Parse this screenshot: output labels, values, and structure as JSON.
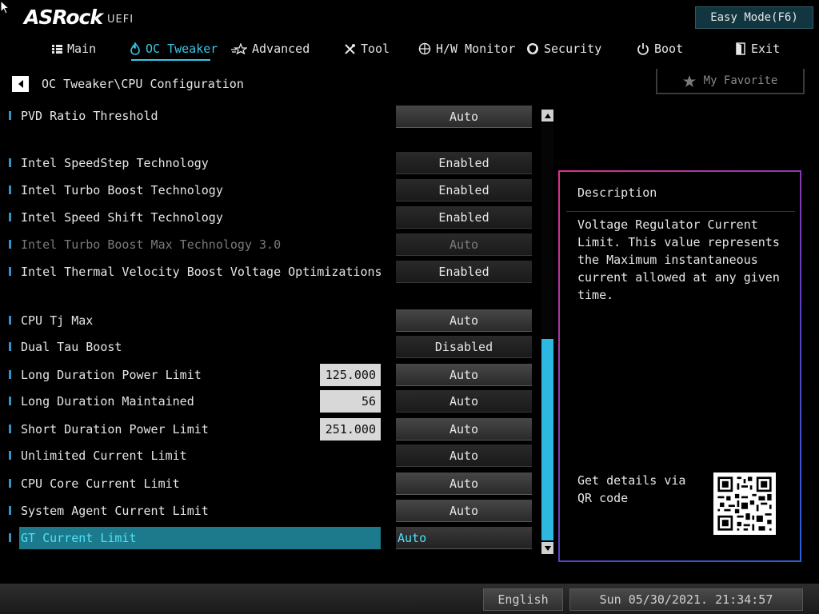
{
  "header": {
    "brand": "ASRock",
    "subbrand": "UEFI",
    "easy_mode_label": "Easy Mode(F6)"
  },
  "nav": {
    "tabs": [
      {
        "label": "Main",
        "icon": "list-icon"
      },
      {
        "label": "OC Tweaker",
        "icon": "flame-icon",
        "active": true
      },
      {
        "label": "Advanced",
        "icon": "star-icon"
      },
      {
        "label": "Tool",
        "icon": "tools-icon"
      },
      {
        "label": "H/W Monitor",
        "icon": "monitor-icon"
      },
      {
        "label": "Security",
        "icon": "shield-icon"
      },
      {
        "label": "Boot",
        "icon": "power-icon"
      },
      {
        "label": "Exit",
        "icon": "exit-icon"
      }
    ]
  },
  "breadcrumb": "OC Tweaker\\CPU Configuration",
  "favorite_label": "My Favorite",
  "settings": [
    {
      "label": "PVD Ratio Threshold",
      "value": "Auto"
    },
    {
      "label": "Intel SpeedStep Technology",
      "value": "Enabled"
    },
    {
      "label": "Intel Turbo Boost Technology",
      "value": "Enabled"
    },
    {
      "label": "Intel Speed Shift Technology",
      "value": "Enabled"
    },
    {
      "label": "Intel Turbo Boost Max Technology 3.0",
      "value": "Auto",
      "disabled": true
    },
    {
      "label": "Intel Thermal Velocity Boost Voltage Optimizations",
      "value": "Enabled"
    },
    {
      "label": "CPU Tj Max",
      "value": "Auto"
    },
    {
      "label": "Dual Tau Boost",
      "value": "Disabled"
    },
    {
      "label": "Long Duration Power Limit",
      "value": "Auto",
      "current": "125.000"
    },
    {
      "label": "Long Duration Maintained",
      "value": "Auto",
      "current": "56"
    },
    {
      "label": "Short Duration Power Limit",
      "value": "Auto",
      "current": "251.000"
    },
    {
      "label": "Unlimited Current Limit",
      "value": "Auto"
    },
    {
      "label": "CPU Core Current Limit",
      "value": "Auto"
    },
    {
      "label": "System Agent Current Limit",
      "value": "Auto"
    },
    {
      "label": "GT Current Limit",
      "value": "Auto",
      "selected": true
    }
  ],
  "description": {
    "title": "Description",
    "text": "Voltage Regulator Current Limit. This value represents the Maximum instantaneous current allowed at any given time.",
    "qr_text": "Get details via QR code"
  },
  "footer": {
    "language": "English",
    "datetime": "Sun 05/30/2021. 21:34:57"
  },
  "colors": {
    "accent": "#38c8ea",
    "selected_row": "#1c7a8c",
    "scroll_thumb": "#2cb8e0"
  }
}
